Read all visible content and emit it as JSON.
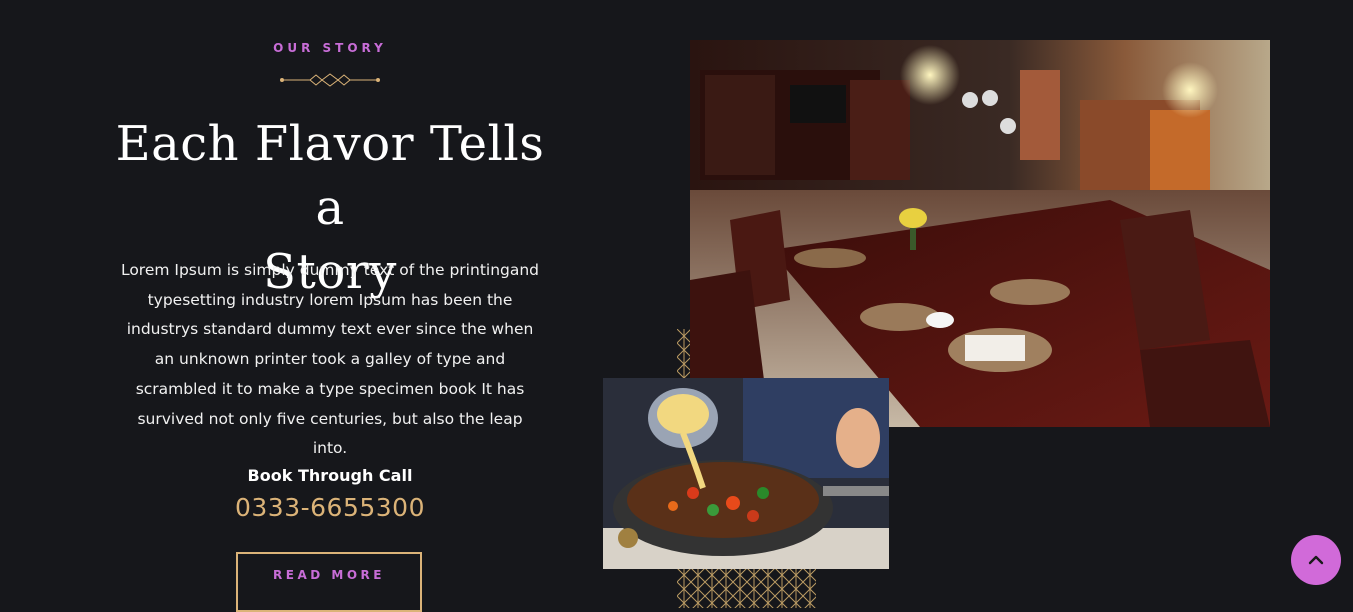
{
  "story": {
    "eyebrow": "OUR STORY",
    "headline_line1": "Each Flavor Tells a",
    "headline_line2": "Story",
    "paragraph": "Lorem Ipsum is simply dummy text of the printingand typesetting industry lorem Ipsum has been the industrys standard dummy text ever since the when an unknown printer took a galley of type and scrambled it to make a type specimen book It has survived not only five centuries, but also the leap into.",
    "book_label": "Book Through Call",
    "phone": "0333-6655300",
    "read_more_label": "READ MORE"
  },
  "images": {
    "main_icon": "restaurant-interior-photo",
    "food_icon": "stir-fry-noodles-photo"
  },
  "scroll_top_icon": "chevron-up-icon",
  "colors": {
    "background": "#16171b",
    "accent_pink": "#c86dd7",
    "accent_gold": "#dbb378",
    "scroll_button": "#d16ad9"
  }
}
